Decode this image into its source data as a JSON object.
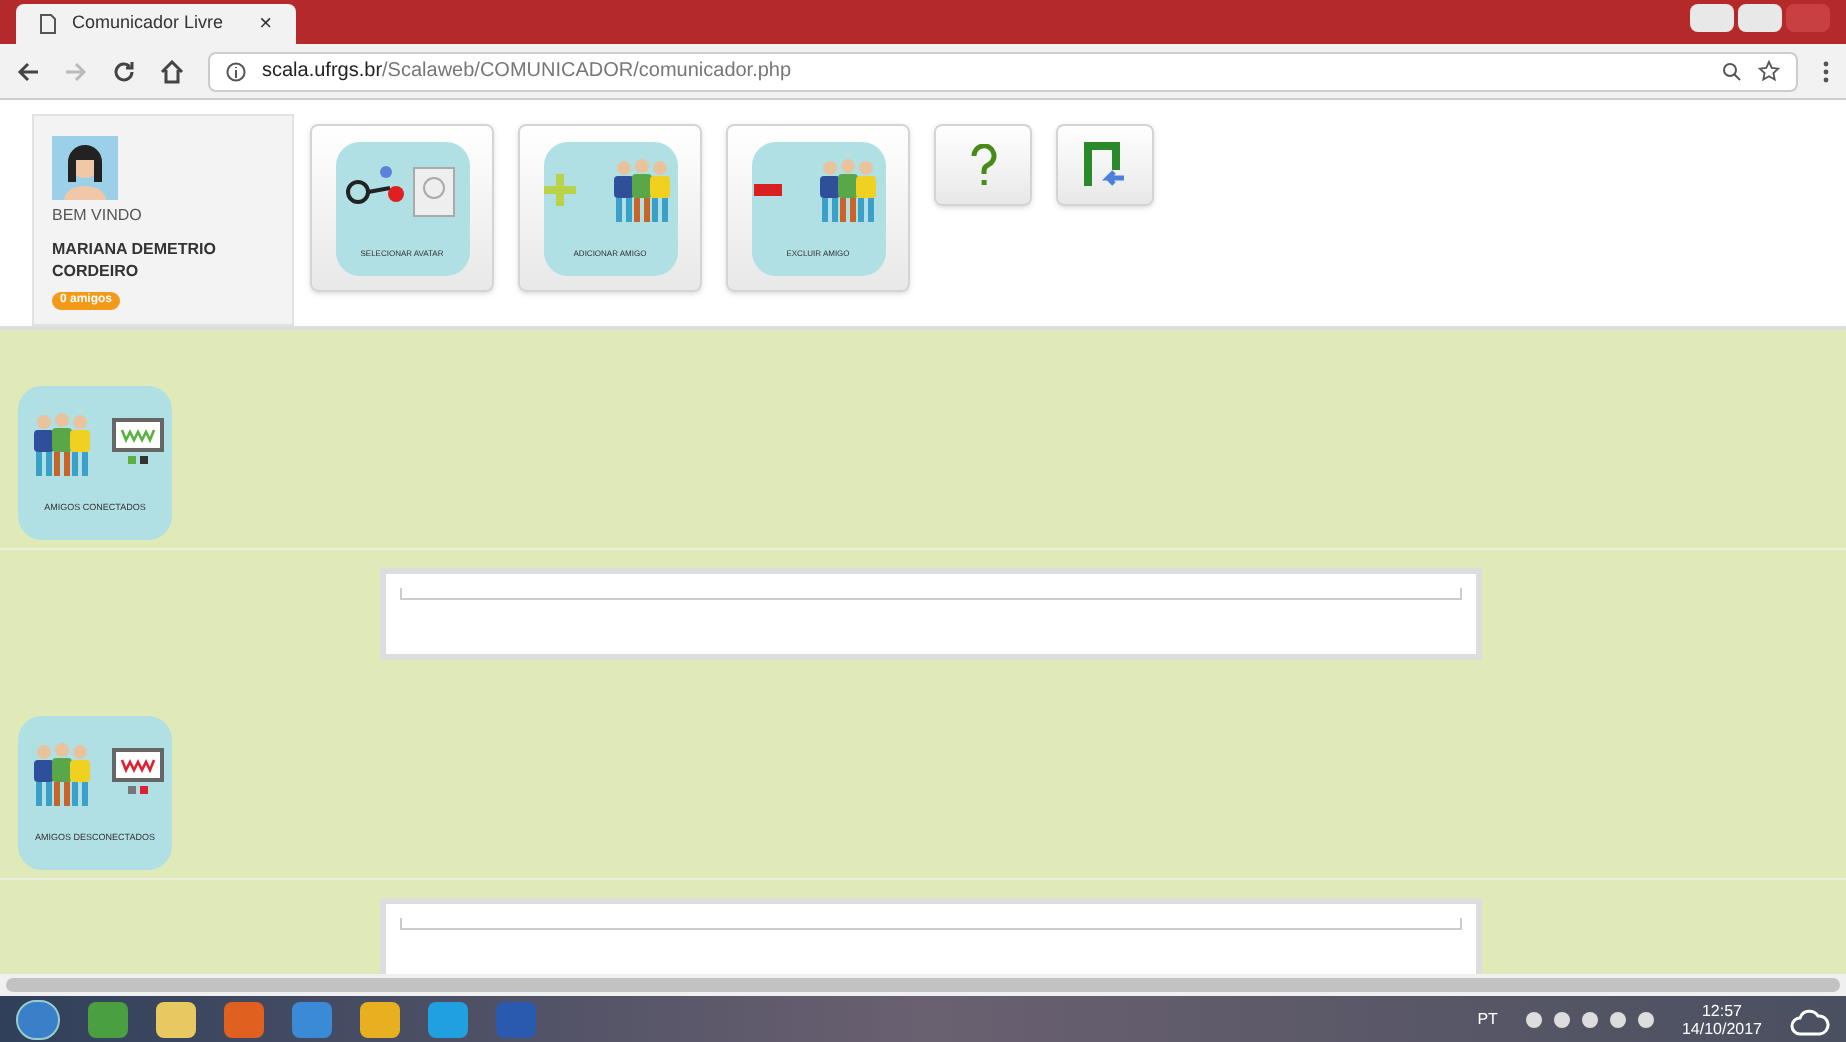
{
  "browser": {
    "tab_title": "Comunicador Livre",
    "tab_close": "×",
    "url_domain": "scala.ufrgs.br",
    "url_path": "/Scalaweb/COMUNICADOR/comunicador.php"
  },
  "user": {
    "greeting": "BEM VINDO",
    "name": "MARIANA DEMETRIO CORDEIRO",
    "friends_badge": "0 amigos"
  },
  "actions": [
    {
      "kind": "avatar",
      "label": "SELECIONAR AVATAR"
    },
    {
      "kind": "add",
      "label": "ADICIONAR AMIGO"
    },
    {
      "kind": "remove",
      "label": "EXCLUIR AMIGO"
    },
    {
      "kind": "help"
    },
    {
      "kind": "exit"
    }
  ],
  "sections": [
    {
      "label": "AMIGOS CONECTADOS",
      "online": true
    },
    {
      "label": "AMIGOS DESCONECTADOS",
      "online": false
    }
  ],
  "taskbar": {
    "language": "PT",
    "time": "12:57",
    "date": "14/10/2017"
  }
}
